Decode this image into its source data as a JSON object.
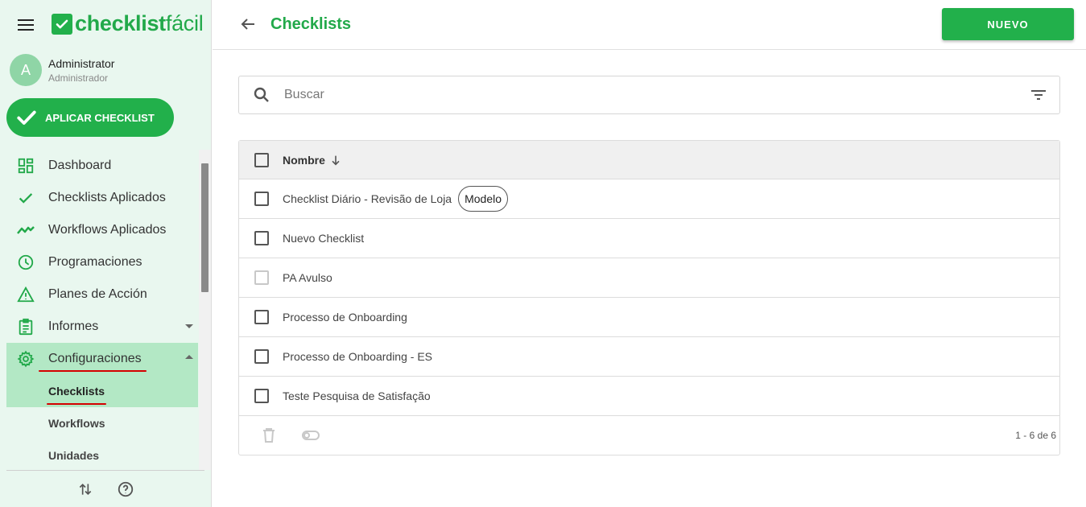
{
  "brand": {
    "logo_text_bold": "checklist",
    "logo_text_thin": "fácil",
    "accent": "#22b04b"
  },
  "user": {
    "initial": "A",
    "name": "Administrator",
    "role": "Administrador"
  },
  "apply_button": {
    "label": "APLICAR CHECKLIST"
  },
  "nav": {
    "items": [
      {
        "label": "Dashboard",
        "icon": "dashboard-icon"
      },
      {
        "label": "Checklists Aplicados",
        "icon": "check-icon"
      },
      {
        "label": "Workflows Aplicados",
        "icon": "trend-icon"
      },
      {
        "label": "Programaciones",
        "icon": "clock-icon"
      },
      {
        "label": "Planes de Acción",
        "icon": "warning-icon"
      },
      {
        "label": "Informes",
        "icon": "report-icon"
      },
      {
        "label": "Configuraciones",
        "icon": "gear-icon"
      }
    ],
    "sub_items": [
      {
        "label": "Checklists"
      },
      {
        "label": "Workflows"
      },
      {
        "label": "Unidades"
      }
    ]
  },
  "header": {
    "title": "Checklists",
    "new_button": "NUEVO"
  },
  "search": {
    "placeholder": "Buscar"
  },
  "table": {
    "column": "Nombre",
    "rows": [
      {
        "name": "Checklist Diário - Revisão de Loja",
        "chip": "Modelo"
      },
      {
        "name": "Nuevo Checklist"
      },
      {
        "name": "PA Avulso"
      },
      {
        "name": "Processo de Onboarding"
      },
      {
        "name": "Processo de Onboarding - ES"
      },
      {
        "name": "Teste Pesquisa de Satisfação"
      }
    ],
    "pagination": "1 - 6 de 6"
  }
}
